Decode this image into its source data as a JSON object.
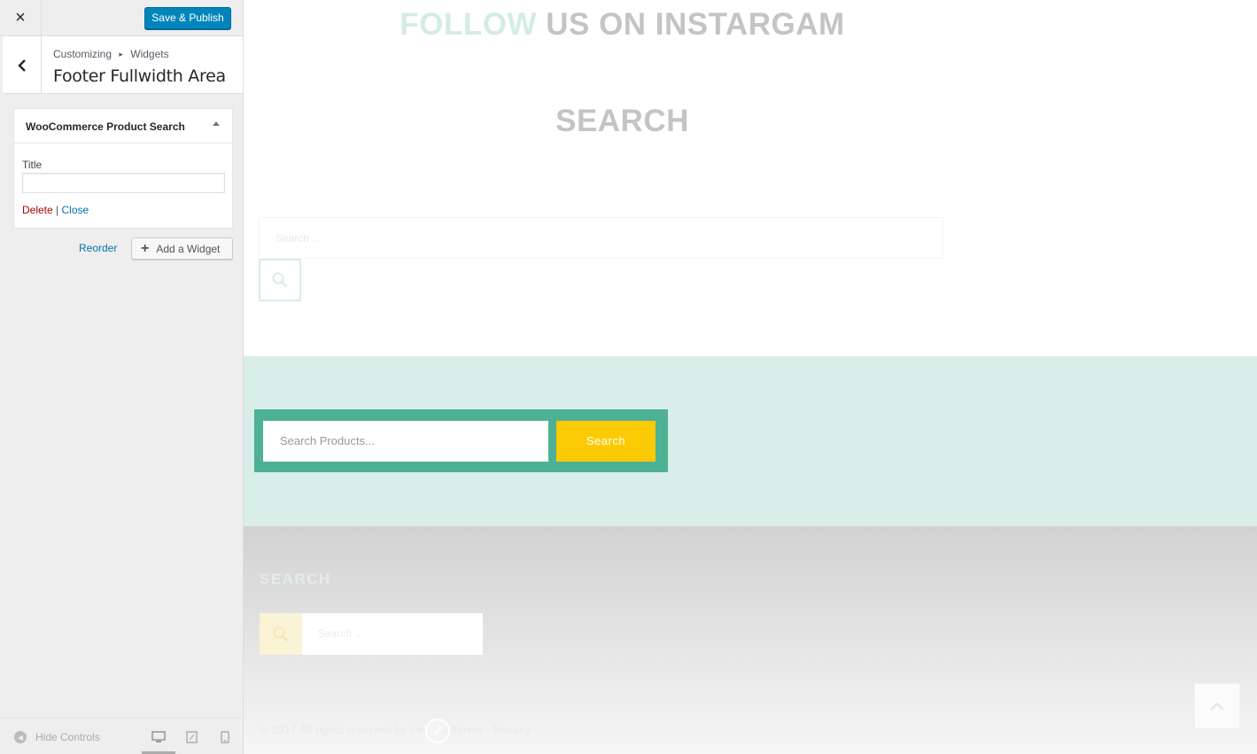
{
  "customizer": {
    "close_icon": "×",
    "publish_label": "Save & Publish",
    "breadcrumb": {
      "root": "Customizing",
      "separator": "▸",
      "current": "Widgets"
    },
    "section_title": "Footer Fullwidth Area",
    "widget": {
      "name": "WooCommerce Product Search",
      "title_label": "Title",
      "title_value": "",
      "delete_label": "Delete",
      "divider": "|",
      "close_label": "Close"
    },
    "reorder_label": "Reorder",
    "add_widget_label": "Add a Widget",
    "hide_controls_label": "Hide Controls",
    "devices": [
      "desktop-icon",
      "tablet-icon",
      "mobile-icon"
    ],
    "colors": {
      "primary": "#0085ba",
      "link": "#0073aa",
      "delete": "#aa0000"
    }
  },
  "preview": {
    "instagram_heading": {
      "accent": "FOLLOW",
      "rest": "US ON INSTARGAM"
    },
    "search_heading": "SEARCH",
    "faint_search_placeholder": "Search ...",
    "product_search": {
      "placeholder": "Search Products...",
      "button_label": "Search"
    },
    "footer": {
      "search_heading": "SEARCH",
      "search_placeholder": "Search ...",
      "copyright": "© 2017 All rights reserved by Pe",
      "links": "/ Terms · Privacy"
    },
    "colors": {
      "accent_green": "#4eb194",
      "mint_band": "#d9eee8",
      "button_yellow": "#fcca05",
      "heading_grey": "#c4c4c4"
    }
  }
}
